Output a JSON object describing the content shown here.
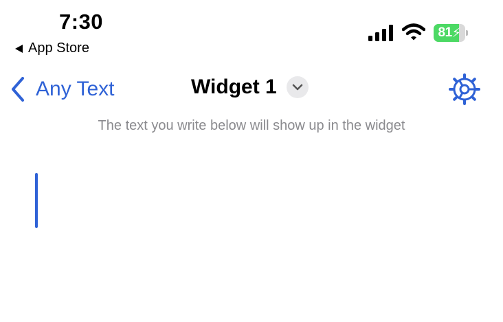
{
  "status_bar": {
    "time": "7:30",
    "back_app_label": "App Store",
    "battery_level": "81",
    "battery_fraction": 0.81,
    "battery_color": "#4cd964",
    "signal_icon": "cellular-signal-icon",
    "wifi_icon": "wifi-icon"
  },
  "nav": {
    "back_label": "Any Text",
    "title": "Widget 1",
    "title_menu_icon": "chevron-down-icon",
    "settings_icon": "gear-icon",
    "accent_color": "#2f62d6"
  },
  "content": {
    "hint": "The text you write below will show up in the widget",
    "text_value": ""
  }
}
